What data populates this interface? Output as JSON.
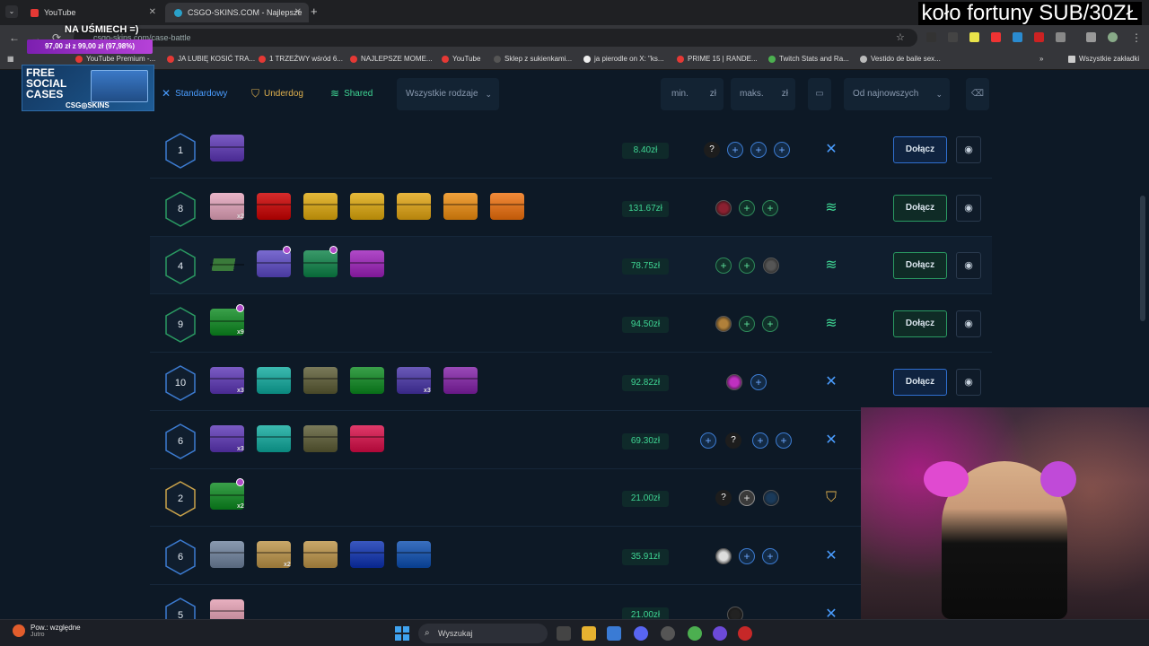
{
  "browser": {
    "tabs": [
      {
        "label": "YouTube",
        "fav": "#e53935"
      },
      {
        "label": "CSGO-SKINS.COM - Najlepsze",
        "fav": "#2aa1c9"
      }
    ],
    "url": "csgo-skins.com/case-battle",
    "bookmarks": [
      "YouTube Premium -...",
      "JA LUBIĘ KOSIĆ TRA...",
      "1 TRZEŹWY wśród 6...",
      "NAJLEPSZE MOME...",
      "YouTube",
      "Sklep z sukienkami...",
      "ja pierodle on X: \"ks...",
      "PRIME 15 | RANDE...",
      "Twitch Stats and Ra...",
      "Vestido de baile sex...",
      "Wszystkie zakładki"
    ]
  },
  "overlay": {
    "stream_title": "koło fortuny SUB/30ZŁ",
    "promo_top": "NA UŚMIECH =)",
    "promo_goal": "97,00 zł z 99,00 zł (97,98%)",
    "promo_big": "FREE SOCIAL CASES",
    "promo_brand": "CSG◎SKINS"
  },
  "filters": {
    "tab_standard": "Standardowy",
    "tab_underdog": "Underdog",
    "tab_shared": "Shared",
    "type_select": "Wszystkie rodzaje",
    "min_placeholder": "min.",
    "max_placeholder": "maks.",
    "currency": "zł",
    "sort_select": "Od najnowszych"
  },
  "battles": [
    {
      "rounds": "1",
      "price": "8.40zł",
      "mode": "standard",
      "join": "Dołącz",
      "accent": "blue"
    },
    {
      "rounds": "8",
      "price": "131.67zł",
      "mode": "shared",
      "join": "Dołącz",
      "accent": "green"
    },
    {
      "rounds": "4",
      "price": "78.75zł",
      "mode": "shared",
      "join": "Dołącz",
      "accent": "green"
    },
    {
      "rounds": "9",
      "price": "94.50zł",
      "mode": "shared",
      "join": "Dołącz",
      "accent": "green"
    },
    {
      "rounds": "10",
      "price": "92.82zł",
      "mode": "standard",
      "join": "Dołącz",
      "accent": "blue"
    },
    {
      "rounds": "6",
      "price": "69.30zł",
      "mode": "standard",
      "join": "",
      "accent": "blue"
    },
    {
      "rounds": "2",
      "price": "21.00zł",
      "mode": "underdog",
      "join": "",
      "accent": "gold"
    },
    {
      "rounds": "6",
      "price": "35.91zł",
      "mode": "standard",
      "join": "",
      "accent": "blue"
    },
    {
      "rounds": "5",
      "price": "21.00zł",
      "mode": "standard",
      "join": "",
      "accent": "blue"
    }
  ],
  "case_qty": {
    "r1": "x2",
    "r3": "x9",
    "r4a": "x3",
    "r4b": "x3",
    "r5": "x3",
    "r6": "x2",
    "r7": "x2"
  },
  "taskbar": {
    "weather_title": "Pow.: względne",
    "weather_sub": "Jutro",
    "search": "Wyszukaj"
  },
  "colors": {
    "accent_blue": "#3c7bd0",
    "accent_green": "#2a9a62",
    "price_green": "#3fd694",
    "gold": "#c9a24a"
  }
}
